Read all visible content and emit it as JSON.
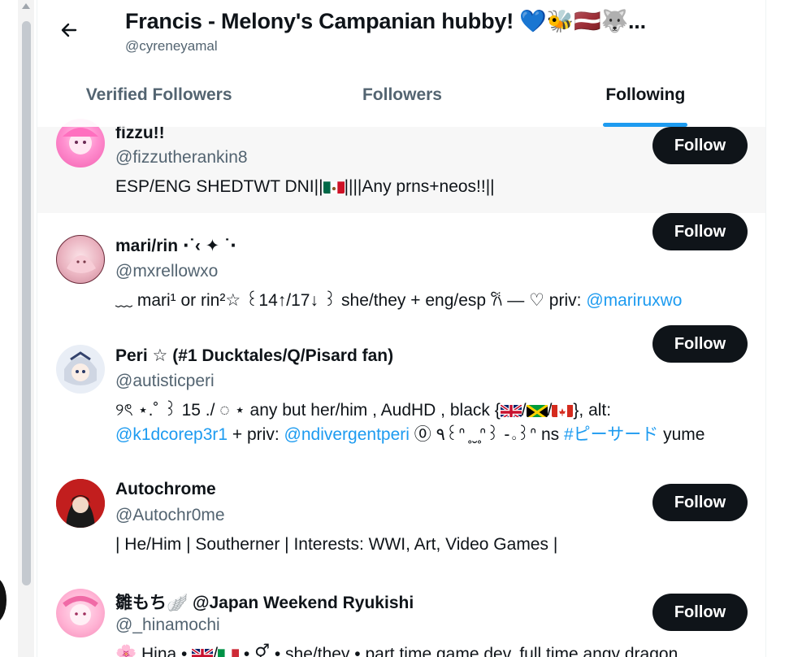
{
  "header": {
    "title": "Francis - Melony's Campanian hubby! 💙🐝🇱🇻🐺...",
    "handle": "@cyreneyamal"
  },
  "tabs": [
    {
      "label": "Verified Followers"
    },
    {
      "label": "Followers"
    },
    {
      "label": "Following"
    }
  ],
  "follow_label": "Follow",
  "users": [
    {
      "name": "fizzu!!",
      "handle": "@fizzutherankin8",
      "bio_1": "ESP/ENG SHEDTWT DNI||",
      "bio_2": "||||Any prns+neos!!||"
    },
    {
      "name": "mari/rin ⋅˙‹ ✦ ˙⋅",
      "handle": "@mxrellowxo",
      "bio_1": "﹏ mari¹ or rin²☆ ꒰14↑/17↓ ꒱ she/they + eng/esp 𐙚 — ♡ priv: ",
      "bio_link": "@mariruxwo"
    },
    {
      "name": "Peri ☆ (#1 Ducktales/Q/Pisard fan)",
      "handle": "@autisticperi",
      "bio_1": "୨ৎ ⋆.˚ ꒱ 15 ./ ◌ ⋆ any but her/him , AudHD , black {",
      "bio_2": "}, alt:",
      "bio_link1": "@k1dcorep3r1",
      "bio_3": " + priv: ",
      "bio_link2": "@ndivergentperi",
      "bio_4": " ⓪ ٩꒰ᐢ ̥ ̮ ̥ᐢ꒱ -｡꒱ᐢ ns ",
      "bio_link3": "#ピーサード",
      "bio_5": " yume"
    },
    {
      "name": "Autochrome",
      "handle": "@Autochr0me",
      "bio_1": "| He/Him | Southerner | Interests: WWI, Art, Video Games |"
    },
    {
      "name": "雛もち🪽 @Japan Weekend Ryukishi",
      "handle": "@_hinamochi",
      "bio_1": "🌸 Hina • ",
      "bio_2": " • ⚥ • she/they • part time game dev, full time angy dragon"
    }
  ],
  "colors": {
    "accent": "#1d9bf0",
    "text": "#0f1419",
    "muted": "#536471",
    "button": "#0f1419"
  }
}
